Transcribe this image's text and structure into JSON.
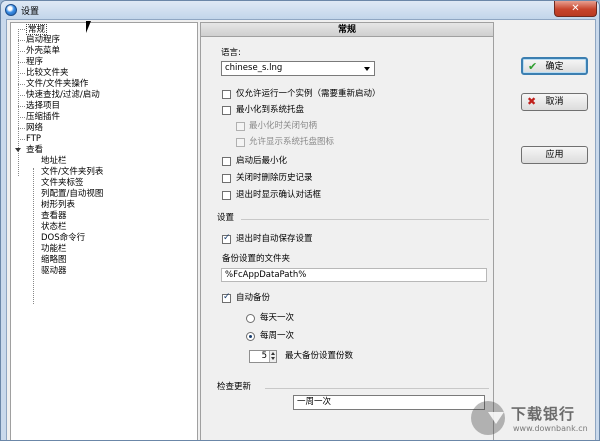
{
  "window": {
    "title": "设置",
    "close_glyph": "✕"
  },
  "tree": {
    "items": [
      {
        "label": "常规",
        "selected": true
      },
      {
        "label": "启动程序"
      },
      {
        "label": "外壳菜单"
      },
      {
        "label": "程序"
      },
      {
        "label": "比较文件夹"
      },
      {
        "label": "文件/文件夹操作"
      },
      {
        "label": "快速查找/过滤/启动"
      },
      {
        "label": "选择项目"
      },
      {
        "label": "压缩插件"
      },
      {
        "label": "网络"
      },
      {
        "label": "FTP"
      },
      {
        "label": "查看"
      }
    ],
    "children": [
      {
        "label": "地址栏"
      },
      {
        "label": "文件/文件夹列表"
      },
      {
        "label": "文件夹标签"
      },
      {
        "label": "列配置/自动视图"
      },
      {
        "label": "树形列表"
      },
      {
        "label": "查看器"
      },
      {
        "label": "状态栏"
      },
      {
        "label": "DOS命令行"
      },
      {
        "label": "功能栏"
      },
      {
        "label": "缩略图"
      },
      {
        "label": "驱动器"
      }
    ]
  },
  "panel": {
    "header": "常规",
    "language_label": "语言:",
    "language_value": "chinese_s.lng",
    "options": [
      {
        "label": "仅允许运行一个实例（需要重新启动）",
        "checked": false,
        "disabled": false
      },
      {
        "label": "最小化到系统托盘",
        "checked": false,
        "disabled": false
      },
      {
        "label": "最小化时关闭句柄",
        "checked": false,
        "disabled": true
      },
      {
        "label": "允许显示系统托盘图标",
        "checked": false,
        "disabled": true
      },
      {
        "label": "启动后最小化",
        "checked": false,
        "disabled": false
      },
      {
        "label": "关闭时删除历史记录",
        "checked": false,
        "disabled": false
      },
      {
        "label": "退出时显示确认对话框",
        "checked": false,
        "disabled": false
      }
    ],
    "settings_group": "设置",
    "save_on_exit": {
      "label": "退出时自动保存设置",
      "checked": true
    },
    "backup_folder_label": "备份设置的文件夹",
    "backup_folder_value": "%FcAppDataPath%",
    "auto_backup": {
      "label": "自动备份",
      "checked": true
    },
    "daily": {
      "label": "每天一次",
      "checked": false
    },
    "weekly": {
      "label": "每周一次",
      "checked": true
    },
    "max_backups_value": "5",
    "max_backups_label": "最大备份设置份数",
    "update_group": "检查更新",
    "update_value": "一周一次"
  },
  "buttons": {
    "ok": {
      "label": "确定",
      "icon": "✔"
    },
    "cancel": {
      "label": "取消",
      "icon": "✖"
    },
    "apply": {
      "label": "应用"
    }
  },
  "watermark": {
    "text": "下载银行",
    "url": "www.downbank.cn"
  },
  "colors": {
    "ok_icon": "#2e9e2e",
    "cancel_icon": "#c0201c",
    "selection_border": "#3c7fb1"
  }
}
